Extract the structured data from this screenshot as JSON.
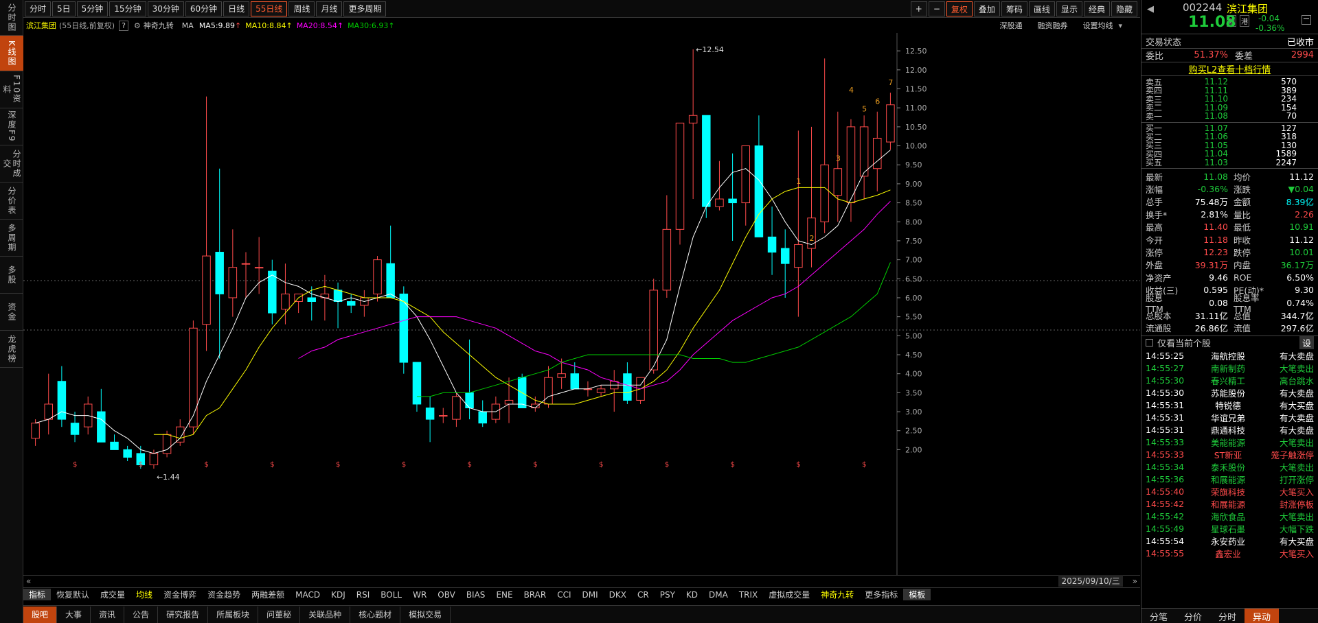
{
  "left_nav": [
    "分时图",
    "K线图",
    "F10资料",
    "深度F9",
    "分时成交",
    "分价表",
    "多周期",
    "多股",
    "资金",
    "龙虎榜"
  ],
  "toolbar": {
    "periods": [
      "分时",
      "5日",
      "5分钟",
      "15分钟",
      "30分钟",
      "60分钟",
      "日线",
      "55日线",
      "周线",
      "月线",
      "更多周期"
    ],
    "active": "55日线",
    "right": [
      "+",
      "−",
      "复权",
      "叠加",
      "筹码",
      "画线",
      "显示",
      "经典",
      "隐藏"
    ]
  },
  "chart_head": {
    "name": "滨江集团",
    "desc": "(55日线,前复权)",
    "help": "?",
    "indicator": "神奇九转",
    "ma_label": "MA",
    "ma5": "MA5:9.89",
    "ma10": "MA10:8.84",
    "ma20": "MA20:8.54",
    "ma30": "MA30:6.93",
    "right_links": [
      "深股通",
      "融资融券",
      "设置均线"
    ]
  },
  "date_label": "2025/09/10/三",
  "indicators": [
    "指标",
    "恢复默认",
    "成交量",
    "均线",
    "资金博弈",
    "资金趋势",
    "两融差额",
    "MACD",
    "KDJ",
    "RSI",
    "BOLL",
    "WR",
    "OBV",
    "BIAS",
    "ENE",
    "BRAR",
    "CCI",
    "DMI",
    "DKX",
    "CR",
    "PSY",
    "KD",
    "DMA",
    "TRIX",
    "虚拟成交量",
    "神奇九转",
    "更多指标",
    "模板"
  ],
  "bottom_tabs": [
    "股吧",
    "大事",
    "资讯",
    "公告",
    "研究报告",
    "所属板块",
    "问董秘",
    "关联品种",
    "核心题材",
    "模拟交易"
  ],
  "quote": {
    "code": "002244",
    "name": "滨江集团",
    "tag1": "融",
    "tag2": "港",
    "price": "11.08",
    "change": "-0.04",
    "pct": "-0.36%",
    "status_label": "交易状态",
    "status": "已收市",
    "wb_label": "委比",
    "wb": "51.37%",
    "wc_label": "委差",
    "wc": "2994",
    "l2": "购买L2查看十档行情"
  },
  "orderbook": {
    "asks": [
      {
        "l": "卖五",
        "p": "11.12",
        "v": "570"
      },
      {
        "l": "卖四",
        "p": "11.11",
        "v": "389"
      },
      {
        "l": "卖三",
        "p": "11.10",
        "v": "234"
      },
      {
        "l": "卖二",
        "p": "11.09",
        "v": "154"
      },
      {
        "l": "卖一",
        "p": "11.08",
        "v": "70"
      }
    ],
    "bids": [
      {
        "l": "买一",
        "p": "11.07",
        "v": "127"
      },
      {
        "l": "买二",
        "p": "11.06",
        "v": "318"
      },
      {
        "l": "买三",
        "p": "11.05",
        "v": "130"
      },
      {
        "l": "买四",
        "p": "11.04",
        "v": "1589"
      },
      {
        "l": "买五",
        "p": "11.03",
        "v": "2247"
      }
    ]
  },
  "stats": [
    [
      "最新",
      "11.08",
      "g",
      "均价",
      "11.12",
      "w"
    ],
    [
      "涨幅",
      "-0.36%",
      "g",
      "涨跌",
      "▼0.04",
      "g"
    ],
    [
      "总手",
      "75.48万",
      "w",
      "金额",
      "8.39亿",
      "c"
    ],
    [
      "换手*",
      "2.81%",
      "w",
      "量比",
      "2.26",
      "r"
    ],
    [
      "最高",
      "11.40",
      "r",
      "最低",
      "10.91",
      "g"
    ],
    [
      "今开",
      "11.18",
      "r",
      "昨收",
      "11.12",
      "w"
    ],
    [
      "涨停",
      "12.23",
      "r",
      "跌停",
      "10.01",
      "g"
    ],
    [
      "外盘",
      "39.31万",
      "r",
      "内盘",
      "36.17万",
      "g"
    ],
    [
      "净资产",
      "9.46",
      "w",
      "ROE",
      "6.50%",
      "w"
    ],
    [
      "收益(三)",
      "0.595",
      "w",
      "PE(动)*",
      "9.30",
      "w"
    ],
    [
      "股息TTM",
      "0.08",
      "w",
      "股息率TTM",
      "0.74%",
      "w"
    ],
    [
      "总股本",
      "31.11亿",
      "w",
      "总值",
      "344.7亿",
      "w"
    ],
    [
      "流通股",
      "26.86亿",
      "w",
      "流值",
      "297.6亿",
      "w"
    ]
  ],
  "ticker_header": {
    "check": "仅看当前个股",
    "btn": "设"
  },
  "ticker": [
    [
      "14:55:25",
      "海航控股",
      "有大卖盘",
      "w",
      "w",
      "w"
    ],
    [
      "14:55:27",
      "南新制药",
      "大笔卖出",
      "g",
      "g",
      "g"
    ],
    [
      "14:55:30",
      "春兴精工",
      "高台跳水",
      "g",
      "g",
      "g"
    ],
    [
      "14:55:30",
      "苏能股份",
      "有大卖盘",
      "w",
      "w",
      "w"
    ],
    [
      "14:55:31",
      "特锐德",
      "有大买盘",
      "w",
      "w",
      "w"
    ],
    [
      "14:55:31",
      "华谊兄弟",
      "有大卖盘",
      "w",
      "w",
      "w"
    ],
    [
      "14:55:31",
      "鼎通科技",
      "有大卖盘",
      "w",
      "w",
      "w"
    ],
    [
      "14:55:33",
      "美能能源",
      "大笔卖出",
      "g",
      "g",
      "g"
    ],
    [
      "14:55:33",
      "ST新亚",
      "笼子触涨停",
      "r",
      "r",
      "r"
    ],
    [
      "14:55:34",
      "泰禾股份",
      "大笔卖出",
      "g",
      "g",
      "g"
    ],
    [
      "14:55:36",
      "和展能源",
      "打开涨停",
      "g",
      "g",
      "g"
    ],
    [
      "14:55:40",
      "荣旗科技",
      "大笔买入",
      "r",
      "r",
      "r"
    ],
    [
      "14:55:42",
      "和展能源",
      "封涨停板",
      "r",
      "r",
      "r"
    ],
    [
      "14:55:42",
      "海欣食品",
      "大笔卖出",
      "g",
      "g",
      "g"
    ],
    [
      "14:55:49",
      "星球石墨",
      "大幅下跌",
      "g",
      "g",
      "g"
    ],
    [
      "14:55:54",
      "永安药业",
      "有大买盘",
      "w",
      "w",
      "w"
    ],
    [
      "14:55:55",
      "鑫宏业",
      "大笔买入",
      "r",
      "r",
      "r"
    ]
  ],
  "rp_tabs": [
    "分笔",
    "分价",
    "分时",
    "异动"
  ],
  "rp_active": "异动",
  "colors": {
    "up": "#ff4b4b",
    "down": "#00ffff",
    "ma5": "#ffffff",
    "ma10": "#ffff00",
    "ma20": "#ff00ff",
    "ma30": "#00cc00",
    "accent": "#c1440e"
  },
  "chart_data": {
    "type": "candlestick",
    "y_ticks": [
      "12.50",
      "12.00",
      "11.50",
      "11.00",
      "10.50",
      "10.00",
      "9.50",
      "9.00",
      "8.50",
      "8.00",
      "7.50",
      "7.00",
      "6.50",
      "6.00",
      "5.50",
      "5.00",
      "4.50",
      "4.00",
      "3.50",
      "3.00",
      "2.50",
      "2.00"
    ],
    "ylim": [
      1.7,
      12.9
    ],
    "high_label": "12.54",
    "low_label": "1.44",
    "nine_turn": [
      "1",
      "2",
      "3",
      "4",
      "5",
      "6",
      "7"
    ],
    "candles": [
      [
        2.3,
        2.8,
        2.1,
        2.7
      ],
      [
        2.8,
        4.0,
        2.4,
        3.2
      ],
      [
        3.8,
        4.2,
        2.6,
        2.8
      ],
      [
        2.7,
        3.0,
        2.2,
        2.4
      ],
      [
        2.6,
        3.4,
        2.4,
        3.2
      ],
      [
        3.0,
        3.6,
        2.2,
        2.2
      ],
      [
        2.2,
        2.4,
        2.0,
        2.0
      ],
      [
        2.0,
        2.1,
        1.7,
        1.8
      ],
      [
        1.9,
        2.1,
        1.5,
        1.6
      ],
      [
        1.6,
        2.0,
        1.5,
        1.9
      ],
      [
        1.9,
        2.5,
        1.8,
        2.4
      ],
      [
        2.2,
        2.8,
        2.1,
        2.6
      ],
      [
        2.6,
        5.4,
        2.4,
        5.2
      ],
      [
        5.3,
        11.3,
        4.6,
        7.1
      ],
      [
        7.2,
        9.4,
        4.4,
        6.1
      ],
      [
        6.0,
        7.8,
        5.5,
        6.8
      ],
      [
        6.9,
        7.2,
        6.0,
        6.9
      ],
      [
        6.8,
        7.6,
        6.1,
        6.8
      ],
      [
        6.7,
        7.0,
        5.3,
        5.6
      ],
      [
        5.7,
        6.9,
        5.3,
        6.1
      ],
      [
        5.9,
        6.0,
        5.6,
        6.1
      ],
      [
        6.0,
        6.3,
        5.4,
        5.9
      ],
      [
        6.0,
        6.6,
        5.4,
        6.1
      ],
      [
        6.2,
        6.4,
        5.2,
        5.9
      ],
      [
        5.9,
        6.1,
        5.6,
        5.8
      ],
      [
        5.8,
        6.2,
        5.5,
        6.0
      ],
      [
        6.1,
        7.1,
        5.9,
        7.0
      ],
      [
        6.9,
        7.9,
        6.0,
        6.0
      ],
      [
        6.1,
        6.3,
        4.0,
        4.3
      ],
      [
        4.3,
        4.3,
        3.0,
        3.2
      ],
      [
        3.1,
        3.4,
        2.2,
        2.8
      ],
      [
        2.9,
        3.1,
        2.7,
        2.9
      ],
      [
        2.8,
        3.5,
        2.6,
        3.4
      ],
      [
        3.5,
        4.9,
        2.8,
        3.1
      ],
      [
        3.0,
        3.3,
        2.6,
        2.7
      ],
      [
        2.8,
        3.4,
        2.7,
        3.2
      ],
      [
        3.2,
        3.9,
        2.7,
        3.3
      ],
      [
        3.9,
        4.0,
        3.1,
        3.1
      ],
      [
        3.1,
        3.4,
        3.0,
        3.2
      ],
      [
        3.2,
        4.2,
        3.1,
        3.9
      ],
      [
        3.9,
        4.4,
        3.6,
        4.0
      ],
      [
        4.0,
        4.3,
        3.6,
        3.6
      ],
      [
        3.6,
        3.8,
        3.4,
        3.6
      ],
      [
        3.5,
        3.7,
        3.4,
        3.6
      ],
      [
        3.6,
        4.1,
        3.0,
        3.8
      ],
      [
        4.0,
        4.3,
        3.2,
        3.3
      ],
      [
        3.3,
        3.8,
        3.2,
        3.9
      ],
      [
        4.1,
        6.5,
        4.0,
        6.2
      ],
      [
        6.2,
        8.7,
        6.0,
        7.8
      ],
      [
        7.8,
        10.6,
        7.4,
        10.6
      ],
      [
        10.6,
        12.54,
        8.6,
        10.8
      ],
      [
        10.8,
        10.8,
        8.1,
        8.4
      ],
      [
        8.4,
        9.6,
        8.3,
        8.6
      ],
      [
        8.6,
        9.8,
        7.5,
        8.5
      ],
      [
        8.5,
        10.0,
        7.9,
        10.0
      ],
      [
        10.0,
        10.8,
        7.8,
        7.6
      ],
      [
        7.6,
        8.4,
        6.6,
        7.2
      ],
      [
        7.3,
        7.8,
        6.0,
        6.9
      ],
      [
        6.8,
        10.4,
        5.5,
        7.4
      ],
      [
        7.3,
        10.5,
        6.8,
        8.1
      ],
      [
        8.0,
        12.3,
        7.7,
        9.5
      ],
      [
        8.7,
        10.9,
        8.0,
        9.4
      ],
      [
        8.5,
        10.7,
        8.0,
        10.5
      ],
      [
        9.2,
        10.8,
        8.6,
        10.5
      ],
      [
        9.4,
        10.9,
        8.8,
        10.2
      ],
      [
        10.1,
        11.4,
        9.9,
        11.08
      ]
    ],
    "ma5": [
      2.7,
      2.8,
      3.0,
      2.9,
      2.9,
      2.8,
      2.5,
      2.3,
      2.0,
      1.9,
      2.0,
      2.3,
      2.9,
      3.8,
      4.5,
      5.2,
      6.0,
      6.4,
      6.6,
      6.4,
      6.3,
      6.1,
      6.0,
      5.9,
      6.0,
      5.9,
      6.0,
      6.1,
      5.9,
      5.5,
      4.9,
      4.2,
      3.5,
      3.1,
      3.0,
      3.0,
      3.2,
      3.2,
      3.1,
      3.4,
      3.5,
      3.6,
      3.6,
      3.7,
      3.7,
      3.7,
      3.7,
      4.2,
      4.9,
      6.3,
      7.6,
      8.4,
      8.9,
      9.3,
      9.4,
      9.1,
      8.6,
      8.0,
      7.5,
      7.4,
      7.6,
      7.9,
      8.6,
      9.3,
      9.6,
      9.89
    ],
    "ma10": [
      null,
      null,
      null,
      null,
      null,
      null,
      null,
      null,
      null,
      2.4,
      2.4,
      2.3,
      2.4,
      2.9,
      3.1,
      3.6,
      4.1,
      4.7,
      5.2,
      5.6,
      6.0,
      6.2,
      6.3,
      6.2,
      6.1,
      6.0,
      6.0,
      6.0,
      5.9,
      5.7,
      5.5,
      5.1,
      4.8,
      4.5,
      4.2,
      3.9,
      3.7,
      3.5,
      3.3,
      3.2,
      3.2,
      3.2,
      3.3,
      3.4,
      3.5,
      3.5,
      3.6,
      3.8,
      4.1,
      4.6,
      5.2,
      5.7,
      6.2,
      6.9,
      7.6,
      8.2,
      8.6,
      8.8,
      8.9,
      8.9,
      8.9,
      8.6,
      8.5,
      8.6,
      8.7,
      8.84
    ],
    "ma20": [
      null,
      null,
      null,
      null,
      null,
      null,
      null,
      null,
      null,
      null,
      null,
      null,
      null,
      null,
      null,
      null,
      null,
      null,
      null,
      null,
      4.4,
      4.6,
      4.7,
      4.9,
      5.0,
      5.1,
      5.2,
      5.3,
      5.4,
      5.5,
      5.5,
      5.5,
      5.5,
      5.4,
      5.3,
      5.2,
      5.0,
      4.8,
      4.6,
      4.5,
      4.3,
      4.2,
      4.1,
      3.9,
      3.8,
      3.7,
      3.6,
      3.7,
      3.8,
      4.1,
      4.5,
      4.8,
      5.1,
      5.4,
      5.6,
      5.8,
      6.0,
      6.1,
      6.3,
      6.6,
      6.9,
      7.2,
      7.5,
      7.8,
      8.2,
      8.54
    ],
    "ma30": [
      null,
      null,
      null,
      null,
      null,
      null,
      null,
      null,
      null,
      null,
      null,
      null,
      null,
      null,
      null,
      null,
      null,
      null,
      null,
      null,
      null,
      null,
      null,
      null,
      null,
      null,
      null,
      null,
      null,
      3.4,
      3.4,
      3.5,
      3.5,
      3.5,
      3.6,
      3.7,
      3.8,
      3.9,
      4.0,
      4.1,
      4.3,
      4.4,
      4.5,
      4.5,
      4.5,
      4.5,
      4.5,
      4.5,
      4.5,
      4.5,
      4.4,
      4.4,
      4.4,
      4.3,
      4.3,
      4.4,
      4.5,
      4.6,
      4.7,
      4.9,
      5.1,
      5.3,
      5.5,
      5.8,
      6.1,
      6.93
    ]
  }
}
